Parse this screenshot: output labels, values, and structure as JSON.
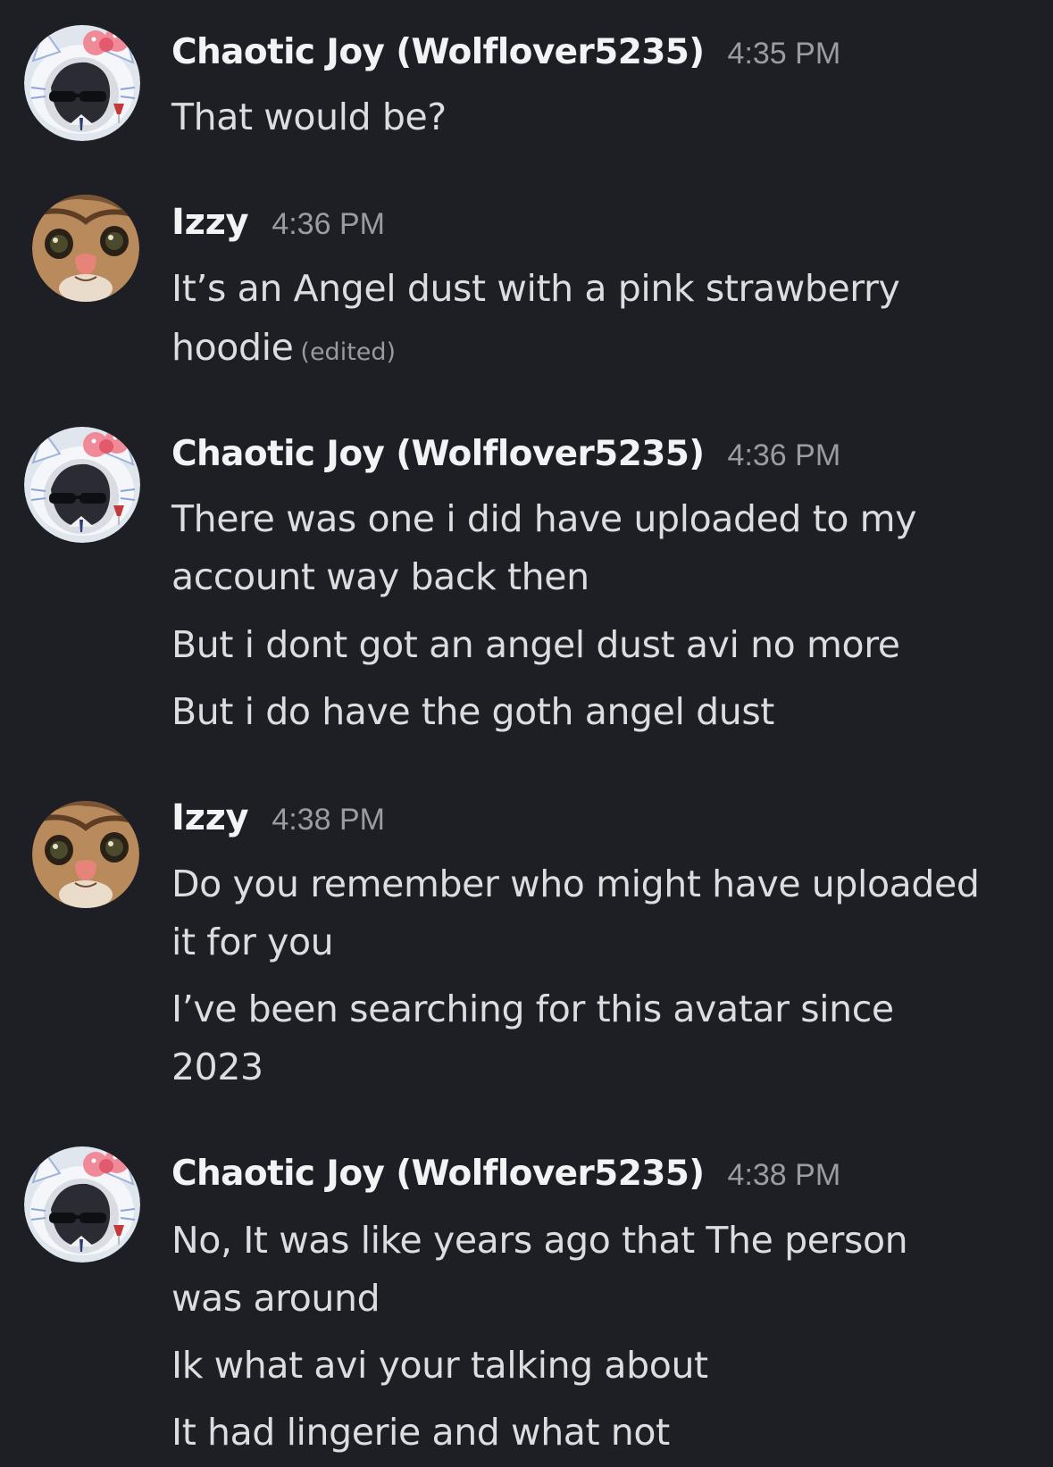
{
  "messages": [
    {
      "author": "Chaotic Joy (Wolflover5235)",
      "time": "4:35 PM",
      "lines": [
        "That would be?"
      ]
    },
    {
      "author": "Izzy",
      "time": "4:36 PM",
      "lines": [
        "It’s an Angel dust with a pink strawberry",
        "hoodie"
      ],
      "edited": "(edited)"
    },
    {
      "author": "Chaotic Joy (Wolflover5235)",
      "time": "4:36 PM",
      "lines": [
        "There was one i did have uploaded to my",
        "account way back then",
        "But i dont got an angel dust avi no more",
        "But i do have the goth angel dust"
      ]
    },
    {
      "author": "Izzy",
      "time": "4:38 PM",
      "lines": [
        "Do you remember who might have uploaded",
        "it for you",
        "I’ve been searching for this avatar since",
        "2023"
      ]
    },
    {
      "author": "Chaotic Joy (Wolflover5235)",
      "time": "4:38 PM",
      "lines": [
        "No, It was like years ago that The person",
        "was around",
        "Ik what avi your talking about",
        "It had lingerie and what not"
      ]
    }
  ]
}
